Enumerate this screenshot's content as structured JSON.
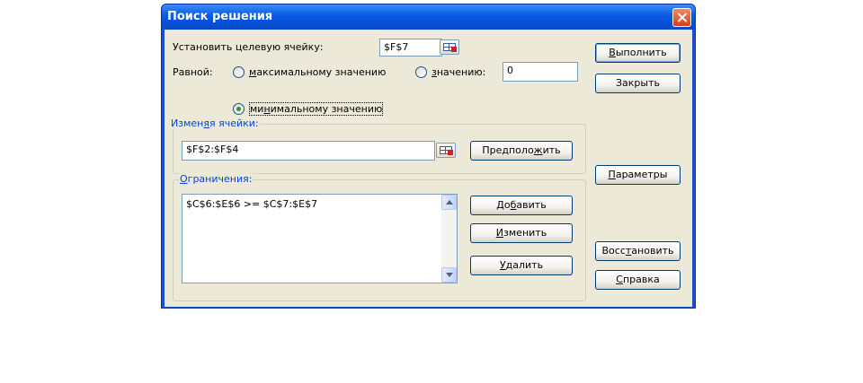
{
  "window": {
    "title": "Поиск решения"
  },
  "target": {
    "label": "Установить целевую ячейку:",
    "value": "$F$7"
  },
  "equal": {
    "label": "Равной:",
    "opt_max_pre": "",
    "opt_max_u": "м",
    "opt_max_post": "аксимальному значению",
    "opt_value_pre": "",
    "opt_value_u": "з",
    "opt_value_post": "начению:",
    "value": "0",
    "opt_min_pre": "ми",
    "opt_min_u": "н",
    "opt_min_post": "имальному значению",
    "selected": "min"
  },
  "changing": {
    "legend_pre": "Измен",
    "legend_u": "я",
    "legend_post": "я ячейки:",
    "value": "$F$2:$F$4"
  },
  "constraints": {
    "legend_pre": "",
    "legend_u": "О",
    "legend_post": "граничения:",
    "items": [
      "$C$6:$E$6 >= $C$7:$E$7"
    ]
  },
  "buttons": {
    "run": {
      "pre": "",
      "u": "В",
      "post": "ыполнить"
    },
    "close": {
      "text": "Закрыть"
    },
    "guess": {
      "pre": "Предполо",
      "u": "ж",
      "post": "ить"
    },
    "params": {
      "pre": "",
      "u": "П",
      "post": "араметры"
    },
    "add": {
      "pre": "До",
      "u": "б",
      "post": "авить"
    },
    "change": {
      "pre": "",
      "u": "И",
      "post": "зменить"
    },
    "delete": {
      "pre": "",
      "u": "У",
      "post": "далить"
    },
    "reset": {
      "pre": "Восс",
      "u": "т",
      "post": "ановить"
    },
    "help": {
      "pre": "",
      "u": "С",
      "post": "правка"
    }
  }
}
